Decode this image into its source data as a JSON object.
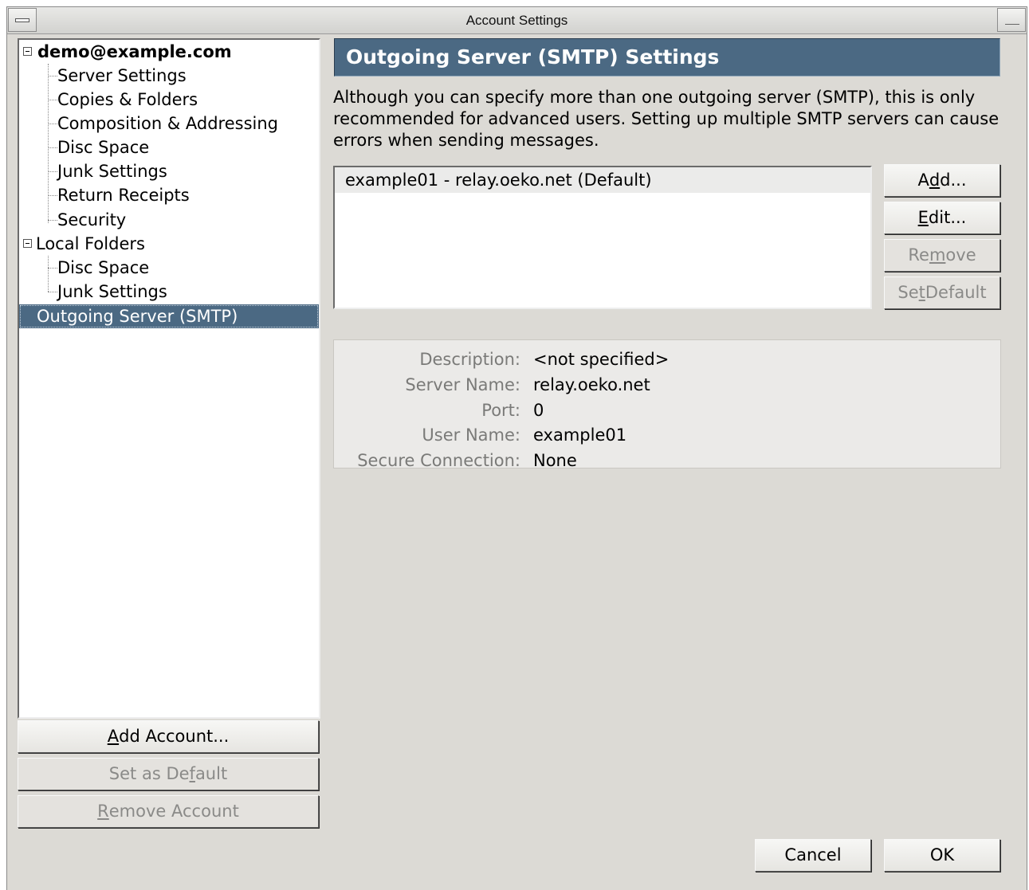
{
  "window": {
    "title": "Account Settings"
  },
  "tree": {
    "account": {
      "label": "demo@example.com",
      "children": [
        "Server Settings",
        "Copies & Folders",
        "Composition & Addressing",
        "Disc Space",
        "Junk Settings",
        "Return Receipts",
        "Security"
      ]
    },
    "local_folders": {
      "label": "Local Folders",
      "children": [
        "Disc Space",
        "Junk Settings"
      ]
    },
    "outgoing": {
      "label": "Outgoing Server (SMTP)"
    }
  },
  "left_buttons": {
    "add_account": {
      "pre": "",
      "key": "A",
      "post": "dd Account..."
    },
    "set_default": {
      "pre": "Set as De",
      "key": "f",
      "post": "ault"
    },
    "remove_account": {
      "pre": "",
      "key": "R",
      "post": "emove Account"
    }
  },
  "panel": {
    "header": "Outgoing Server (SMTP) Settings",
    "description": "Although you can specify more than one outgoing server (SMTP), this is only recommended for advanced users. Setting up multiple SMTP servers can cause errors when sending messages.",
    "servers": [
      "example01 - relay.oeko.net (Default)"
    ],
    "buttons": {
      "add": {
        "pre": "A",
        "key": "d",
        "post": "d..."
      },
      "edit": {
        "pre": "",
        "key": "E",
        "post": "dit..."
      },
      "remove": {
        "pre": "Re",
        "key": "m",
        "post": "ove"
      },
      "set_default": {
        "pre": "Se",
        "key": "t",
        "post": " Default"
      }
    },
    "details": {
      "description": {
        "label": "Description:",
        "value": "<not specified>"
      },
      "server_name": {
        "label": "Server Name:",
        "value": "relay.oeko.net"
      },
      "port": {
        "label": "Port:",
        "value": "0"
      },
      "user_name": {
        "label": "User Name:",
        "value": "example01"
      },
      "secure_connection": {
        "label": "Secure Connection:",
        "value": "None"
      }
    }
  },
  "footer": {
    "cancel": "Cancel",
    "ok": "OK"
  },
  "colors": {
    "selection": "#4b6983",
    "background": "#dcdad5"
  }
}
